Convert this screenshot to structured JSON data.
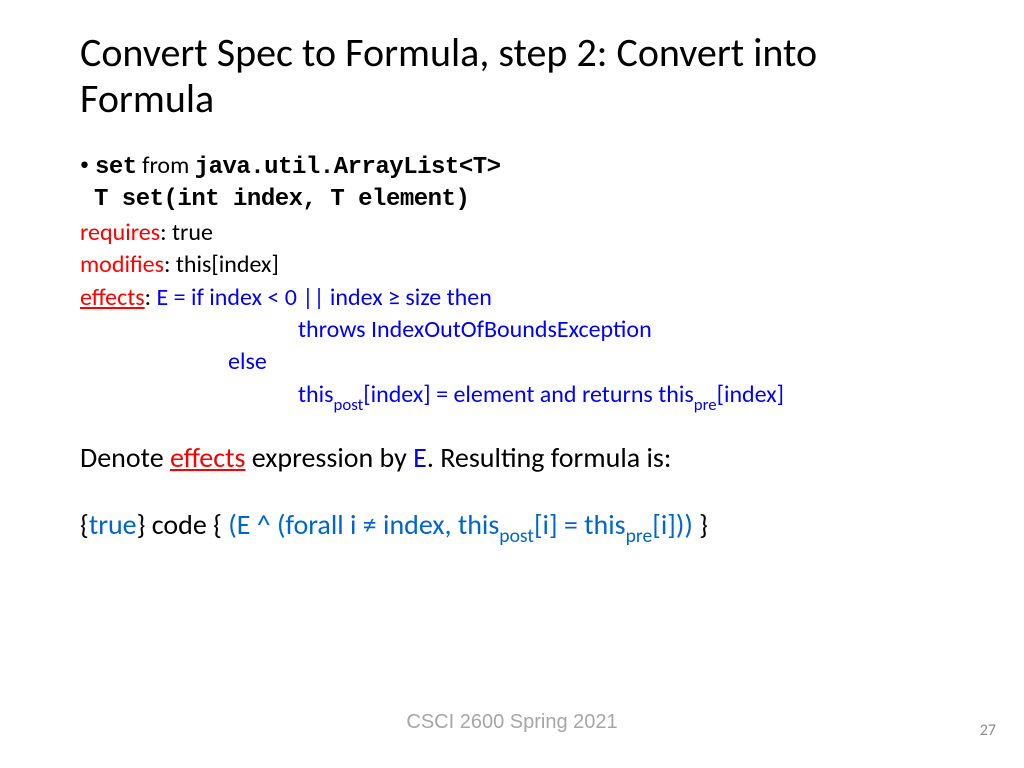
{
  "title": "Convert Spec to Formula, step 2: Convert into Formula",
  "line1": {
    "code1": "set",
    "plain": " from ",
    "code2": "java.util.ArrayList<T>"
  },
  "line2": "T set(int index, T element)",
  "requires": {
    "label": "requires",
    "sep": ": ",
    "value": "true"
  },
  "modifies": {
    "label": "modifies",
    "sep": ": ",
    "value": "this[index]"
  },
  "effects": {
    "label": "effects",
    "sep": ": ",
    "seg1": "E = if index < 0 || index ≥ size then",
    "seg2": "throws IndexOutOfBoundsException",
    "seg3": "else",
    "seg4a": "this",
    "seg4b": "post",
    "seg4c": "[index] = element and returns this",
    "seg4d": "pre",
    "seg4e": "[index]"
  },
  "denote": {
    "a": "Denote ",
    "b": "effects",
    "c": " expression by ",
    "d": "E",
    "e": ". Resulting formula is:"
  },
  "formula": {
    "a": "{",
    "b": "true",
    "c": "} code { ",
    "d": "(E ^ (forall i ≠ index, this",
    "e": "post",
    "f": "[i] = this",
    "g": "pre",
    "h": "[i]))",
    "i": " }"
  },
  "footer": "CSCI 2600 Spring 2021",
  "page": "27"
}
